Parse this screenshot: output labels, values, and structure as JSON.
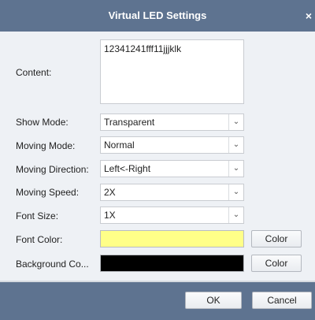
{
  "dialog": {
    "title": "Virtual LED Settings",
    "close_glyph": "×"
  },
  "form": {
    "content": {
      "label": "Content:",
      "value": "12341241fff11jjjklk"
    },
    "show_mode": {
      "label": "Show Mode:",
      "value": "Transparent"
    },
    "moving_mode": {
      "label": "Moving Mode:",
      "value": "Normal"
    },
    "moving_direction": {
      "label": "Moving Direction:",
      "value": "Left<-Right"
    },
    "moving_speed": {
      "label": "Moving Speed:",
      "value": "2X"
    },
    "font_size": {
      "label": "Font Size:",
      "value": "1X"
    },
    "font_color": {
      "label": "Font Color:",
      "swatch_color": "#ffff88",
      "button_label": "Color"
    },
    "background_color": {
      "label": "Background Co...",
      "swatch_color": "#000000",
      "button_label": "Color"
    }
  },
  "footer": {
    "ok_label": "OK",
    "cancel_label": "Cancel"
  },
  "colors": {
    "titlebar": "#5e7390",
    "footer": "#5e7390",
    "body": "#eef1f5"
  },
  "icons": {
    "dropdown": "chevron-down-icon",
    "close": "close-icon"
  }
}
